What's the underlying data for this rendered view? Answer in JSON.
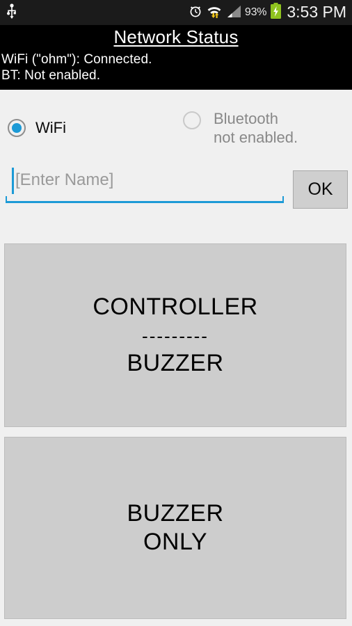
{
  "statusbar": {
    "usb_icon": "usb-icon",
    "alarm_icon": "alarm-clock-icon",
    "wifi_icon": "wifi-transfer-icon",
    "signal_icon": "cell-signal-icon",
    "battery_percent": "93%",
    "battery_icon": "battery-charging-icon",
    "time": "3:53 PM",
    "background_color": "#1b1b1b",
    "text_color": "#f2f2f2",
    "battery_color": "#8fc31f"
  },
  "header": {
    "title": "Network Status",
    "wifi_status": "WiFi (\"ohm\"): Connected.",
    "bt_status": "BT: Not enabled.",
    "background_color": "#000000"
  },
  "options": {
    "wifi": {
      "label": "WiFi",
      "selected": true,
      "accent_color": "#1c9ad6"
    },
    "bluetooth": {
      "label": "Bluetooth\nnot enabled.",
      "selected": false,
      "disabled": true,
      "text_color": "#888888"
    }
  },
  "name_row": {
    "input_value": "",
    "input_placeholder": "[Enter Name]",
    "underline_color": "#1c9ad6",
    "ok_label": "OK"
  },
  "buttons": {
    "controller_buzzer": {
      "line1": "CONTROLLER",
      "separator": "---------",
      "line2": "BUZZER",
      "background_color": "#cdcdcd"
    },
    "buzzer_only": {
      "line1": "BUZZER",
      "line2": "ONLY",
      "background_color": "#cdcdcd"
    }
  }
}
